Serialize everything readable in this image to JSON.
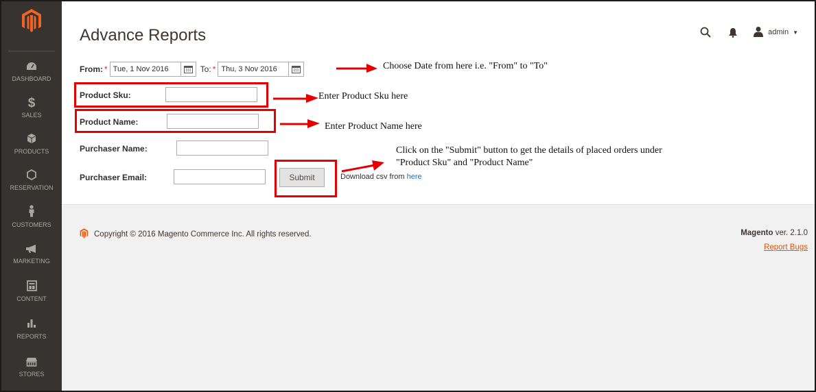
{
  "header": {
    "title": "Advance Reports",
    "user": "admin"
  },
  "sidebar": {
    "items": [
      {
        "label": "DASHBOARD",
        "icon": "dashboard-icon"
      },
      {
        "label": "SALES",
        "icon": "dollar-icon"
      },
      {
        "label": "PRODUCTS",
        "icon": "cube-icon"
      },
      {
        "label": "RESERVATION",
        "icon": "hexagon-icon"
      },
      {
        "label": "CUSTOMERS",
        "icon": "person-icon"
      },
      {
        "label": "MARKETING",
        "icon": "megaphone-icon"
      },
      {
        "label": "CONTENT",
        "icon": "layout-icon"
      },
      {
        "label": "REPORTS",
        "icon": "bar-chart-icon"
      },
      {
        "label": "STORES",
        "icon": "store-icon"
      }
    ]
  },
  "form": {
    "from_label": "From:",
    "from_value": "Tue, 1 Nov 2016",
    "to_label": "To:",
    "to_value": "Thu, 3 Nov 2016",
    "required_mark": "*",
    "product_sku_label": "Product Sku:",
    "product_name_label": "Product Name:",
    "purchaser_name_label": "Purchaser Name:",
    "purchaser_email_label": "Purchaser Email:",
    "submit_label": "Submit",
    "download_text": "Download csv from",
    "download_link": "here"
  },
  "annotations": {
    "date": "Choose Date from here i.e. \"From\" to \"To\"",
    "sku": "Enter Product Sku here",
    "name": "Enter Product Name here",
    "submit_line1": "Click on the \"Submit\" button to get the details of placed orders under",
    "submit_line2": "\"Product Sku\" and \"Product Name\""
  },
  "footer": {
    "copyright": "Copyright © 2016 Magento Commerce Inc. All rights reserved.",
    "brand": "Magento",
    "version": "ver. 2.1.0",
    "report_bugs": "Report Bugs"
  },
  "colors": {
    "sidebar_bg": "#373330",
    "brand_orange": "#eb5202",
    "annotation_red": "#e40000",
    "link_blue": "#007bdb"
  }
}
